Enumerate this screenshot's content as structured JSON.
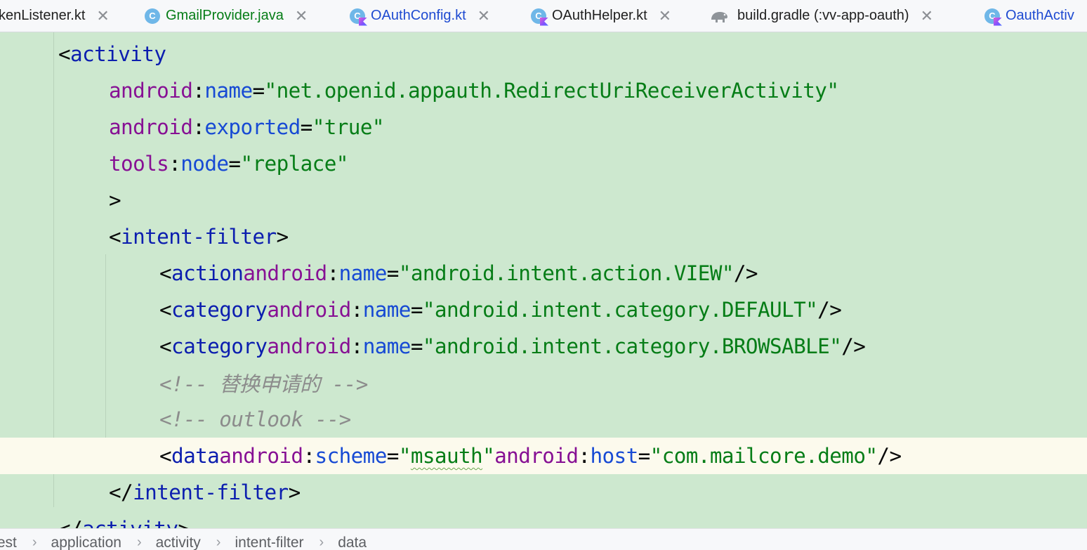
{
  "tabs": [
    {
      "label": "kenListener.kt",
      "type": "kotlin"
    },
    {
      "label": "GmailProvider.java",
      "type": "java"
    },
    {
      "label": "OAuthConfig.kt",
      "type": "kotlin"
    },
    {
      "label": "OAuthHelper.kt",
      "type": "kotlin"
    },
    {
      "label": "build.gradle (:vv-app-oauth)",
      "type": "gradle"
    },
    {
      "label": "OauthActiv",
      "type": "kotlin"
    }
  ],
  "colors": {
    "editor_bg": "#cde8cf",
    "current_line_bg": "#fcfaed",
    "tag": "#0c1eaf",
    "namespace": "#871094",
    "attribute": "#174ad4",
    "value": "#067d17",
    "comment": "#8c8c8c",
    "java_tab_text": "#067d17",
    "kotlin_tab_text": "#1f4bd1"
  },
  "editor": {
    "lines": [
      {
        "text": "<activity"
      },
      {
        "text": "android:name=\"net.openid.appauth.RedirectUriReceiverActivity\""
      },
      {
        "text": "android:exported=\"true\""
      },
      {
        "text": "tools:node=\"replace\""
      },
      {
        "text": ">"
      },
      {
        "text": "<intent-filter>"
      },
      {
        "text": "<action android:name=\"android.intent.action.VIEW\"/>"
      },
      {
        "text": "<category android:name=\"android.intent.category.DEFAULT\"/>"
      },
      {
        "text": "<category android:name=\"android.intent.category.BROWSABLE\"/>"
      },
      {
        "text": "<!-- 替换申请的 -->"
      },
      {
        "text": "<!-- outlook -->"
      },
      {
        "text": "<data android:scheme=\"msauth\" android:host=\"com.mailcore.demo\"/>",
        "current": true
      },
      {
        "text": "</intent-filter>"
      },
      {
        "text": "</activity>"
      }
    ]
  },
  "breadcrumb": [
    "fest",
    "application",
    "activity",
    "intent-filter",
    "data"
  ],
  "icons": {
    "kotlin_class": "kotlin-class-icon",
    "java_class": "java-class-icon",
    "gradle": "gradle-elephant-icon",
    "close": "close-icon",
    "breadcrumb_separator": "chevron-right-icon"
  }
}
